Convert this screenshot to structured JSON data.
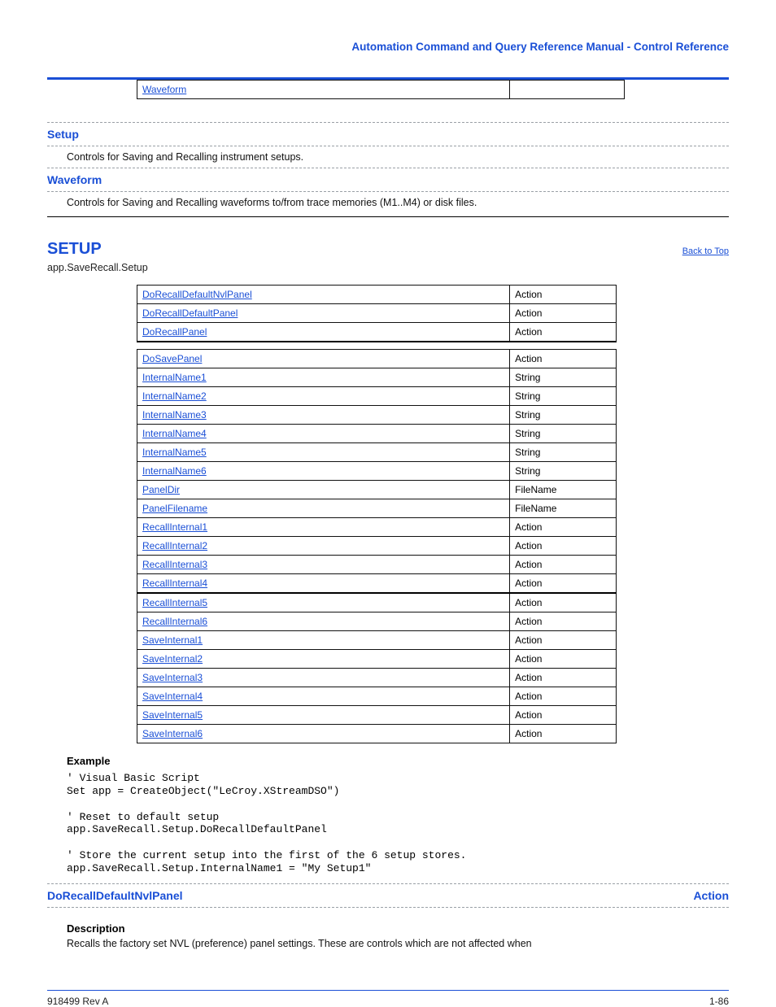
{
  "header": {
    "brand": "Automation Command and Query Reference Manual - Control Reference"
  },
  "topTable": {
    "rows": [
      {
        "name": "Waveform",
        "type": ""
      }
    ]
  },
  "entries": [
    {
      "name": "Setup",
      "type": "",
      "desc": "Controls for Saving and Recalling instrument setups."
    },
    {
      "name": "Waveform",
      "type": "",
      "desc": "Controls for Saving and Recalling waveforms to/from trace memories (M1..M4) or disk files."
    }
  ],
  "section": {
    "title": "SETUP",
    "back": "Back to Top",
    "path": "app.SaveRecall.Setup"
  },
  "setupTable": {
    "rows": [
      {
        "name": "DoRecallDefaultNvlPanel",
        "type": "Action"
      },
      {
        "name": "DoRecallDefaultPanel",
        "type": "Action"
      },
      {
        "name": "DoRecallPanel",
        "type": "Action",
        "heavy": true
      },
      {
        "name": "DoSavePanel",
        "type": "Action",
        "spacer_before": true
      },
      {
        "name": "InternalName1",
        "type": "String"
      },
      {
        "name": "InternalName2",
        "type": "String"
      },
      {
        "name": "InternalName3",
        "type": "String"
      },
      {
        "name": "InternalName4",
        "type": "String"
      },
      {
        "name": "InternalName5",
        "type": "String"
      },
      {
        "name": "InternalName6",
        "type": "String"
      },
      {
        "name": "PanelDir",
        "type": "FileName"
      },
      {
        "name": "PanelFilename",
        "type": "FileName"
      },
      {
        "name": "RecallInternal1",
        "type": "Action"
      },
      {
        "name": "RecallInternal2",
        "type": "Action"
      },
      {
        "name": "RecallInternal3",
        "type": "Action"
      },
      {
        "name": "RecallInternal4",
        "type": "Action",
        "heavy": true
      },
      {
        "name": "RecallInternal5",
        "type": "Action"
      },
      {
        "name": "RecallInternal6",
        "type": "Action"
      },
      {
        "name": "SaveInternal1",
        "type": "Action"
      },
      {
        "name": "SaveInternal2",
        "type": "Action"
      },
      {
        "name": "SaveInternal3",
        "type": "Action"
      },
      {
        "name": "SaveInternal4",
        "type": "Action"
      },
      {
        "name": "SaveInternal5",
        "type": "Action"
      },
      {
        "name": "SaveInternal6",
        "type": "Action"
      }
    ]
  },
  "example": {
    "heading": "Example",
    "code": "' Visual Basic Script\nSet app = CreateObject(\"LeCroy.XStreamDSO\")\n\n' Reset to default setup\napp.SaveRecall.Setup.DoRecallDefaultPanel\n\n' Store the current setup into the first of the 6 setup stores.\napp.SaveRecall.Setup.InternalName1 = \"My Setup1\""
  },
  "finalEntry": {
    "name": "DoRecallDefaultNvlPanel",
    "type": "Action",
    "descHeading": "Description",
    "desc": "Recalls the factory set NVL (preference) panel settings. These are controls which are not affected when"
  },
  "footer": {
    "left": "918499 Rev A",
    "right": "1-86"
  }
}
